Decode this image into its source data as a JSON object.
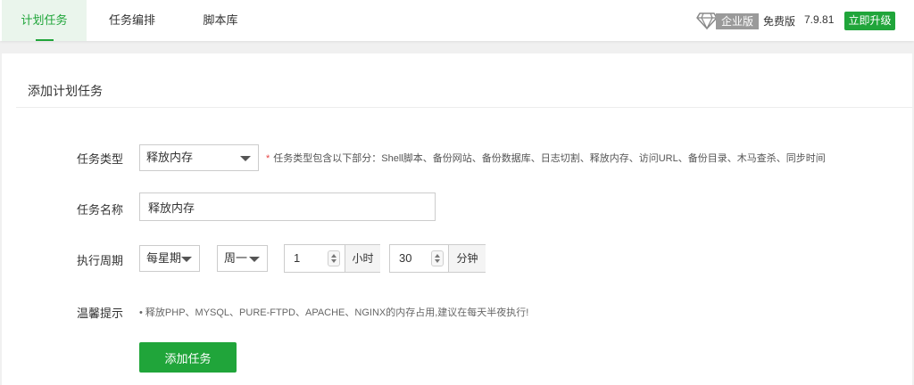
{
  "nav": {
    "tabs": [
      {
        "label": "计划任务",
        "active": true
      },
      {
        "label": "任务编排",
        "active": false
      },
      {
        "label": "脚本库",
        "active": false
      }
    ],
    "enterprise_icon": "diamond-icon",
    "enterprise_label": "企业版",
    "free_label": "免费版",
    "version": "7.9.81",
    "upgrade_label": "立即升级"
  },
  "panel": {
    "title": "添加计划任务",
    "task_type": {
      "label": "任务类型",
      "value": "释放内存",
      "hint_star": "*",
      "hint": "任务类型包含以下部分：Shell脚本、备份网站、备份数据库、日志切割、释放内存、访问URL、备份目录、木马查杀、同步时间"
    },
    "task_name": {
      "label": "任务名称",
      "value": "释放内存"
    },
    "period": {
      "label": "执行周期",
      "cycle_value": "每星期",
      "weekday_value": "周一",
      "hour_value": "1",
      "hour_unit": "小时",
      "minute_value": "30",
      "minute_unit": "分钟"
    },
    "tip": {
      "label": "温馨提示",
      "text": "• 释放PHP、MYSQL、PURE-FTPD、APACHE、NGINX的内存占用,建议在每天半夜执行!"
    },
    "submit_label": "添加任务"
  },
  "colors": {
    "accent": "#20a53a",
    "required_star": "#e84545",
    "enterprise_badge": "#9a9a9a"
  }
}
